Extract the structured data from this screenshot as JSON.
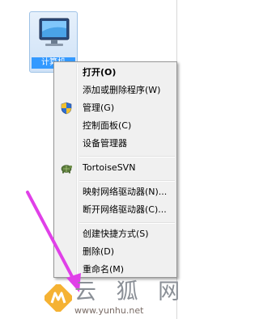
{
  "desktop_icon": {
    "label": "计算机",
    "icon": "computer-monitor-icon"
  },
  "context_menu": {
    "items": [
      {
        "label": "打开(O)",
        "bold": true
      },
      {
        "label": "添加或删除程序(W)"
      },
      {
        "label": "管理(G)",
        "icon": "uac-shield-icon"
      },
      {
        "label": "控制面板(C)"
      },
      {
        "label": "设备管理器"
      },
      {
        "label": "TortoiseSVN",
        "icon": "tortoisesvn-icon"
      },
      {
        "label": "映射网络驱动器(N)..."
      },
      {
        "label": "断开网络驱动器(C)..."
      },
      {
        "label": "创建快捷方式(S)"
      },
      {
        "label": "删除(D)"
      },
      {
        "label": "重命名(M)"
      }
    ]
  },
  "annotation": {
    "arrow_color": "#e040e8"
  },
  "watermark": {
    "text": "云 狐 网",
    "url": "www.yunhu.net",
    "logo": "yunhu-logo-icon"
  }
}
